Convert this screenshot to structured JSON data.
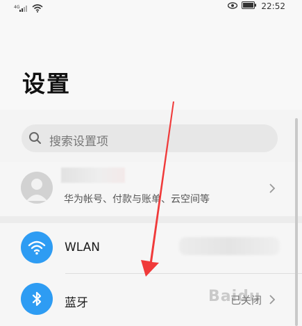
{
  "status_bar": {
    "time": "22:52",
    "network_label": "4G",
    "icons": [
      "signal-icon",
      "wifi-icon",
      "eye-icon",
      "battery-icon"
    ]
  },
  "page": {
    "title": "设置"
  },
  "search": {
    "placeholder": "搜索设置项"
  },
  "account": {
    "subtitle": "华为帐号、付款与账单、云空间等"
  },
  "items": [
    {
      "label": "WLAN",
      "icon": "wifi-icon",
      "value": ""
    },
    {
      "label": "蓝牙",
      "icon": "bluetooth-icon",
      "value": "已关闭"
    }
  ],
  "watermark": "Baidu",
  "colors": {
    "accent": "#2e9cf3",
    "annotation_arrow": "#f03a3a"
  }
}
